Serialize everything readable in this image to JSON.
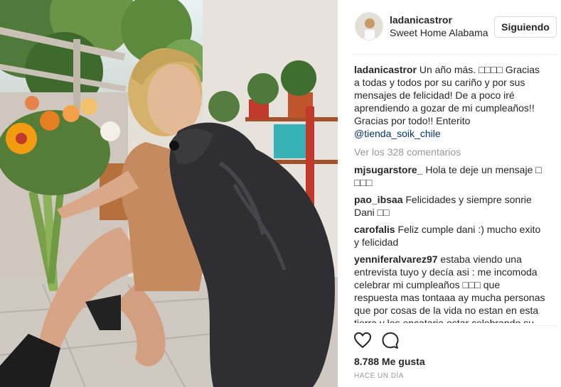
{
  "post": {
    "username": "ladanicastror",
    "location": "Sweet Home Alabama",
    "follow_label": "Siguiendo",
    "caption": {
      "user": "ladanicastror",
      "text": "Un año más. □□□□ Gracias a todas y todos por su cariño y por sus mensajes de felicidad! De a poco iré aprendiendo a gozar de mi cumpleaños!! Gracias por todo!! Enterito",
      "mention": "@tienda_soik_chile"
    },
    "view_comments": "Ver los 328 comentarios",
    "comments": [
      {
        "user": "mjsugarstore_",
        "text": "Hola te deje un mensaje □ □□□"
      },
      {
        "user": "pao_ibsaa",
        "text": "Felicidades y siempre sonrie Dani □□"
      },
      {
        "user": "carofalis",
        "text": "Feliz cumple dani :) mucho exito y felicidad"
      },
      {
        "user": "yenniferalvarez97",
        "text": "estaba viendo una entrevista tuyo y decía asi : me incomoda celebrar mi cumpleaños □□□ que respuesta mas tontaaa ay mucha personas que por cosas de la vida no estan en esta tierra y les encataria estar celebrando su dia y personas egocentricas como tu no le"
      }
    ],
    "likes": "8.788 Me gusta",
    "time": "HACE UN DÍA",
    "icons": {
      "like": "heart-icon",
      "comment": "comment-icon"
    }
  }
}
